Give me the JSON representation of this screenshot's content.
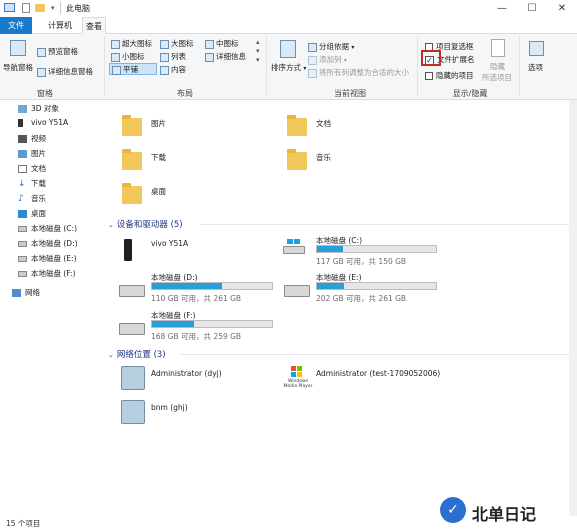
{
  "title": "此电脑",
  "window": {
    "minimize": "—",
    "maximize": "☐",
    "close": "✕"
  },
  "tabs": [
    {
      "label": "文件"
    },
    {
      "label": "计算机"
    },
    {
      "label": "查看"
    }
  ],
  "ribbon": {
    "pane_group": {
      "label": "窗格",
      "nav_pane": "导航窗格",
      "preview_pane": "预览窗格",
      "details_pane": "详细信息窗格"
    },
    "layout_group": {
      "label": "布局",
      "options": [
        "超大图标",
        "大图标",
        "中图标",
        "小图标",
        "列表",
        "详细信息",
        "平铺",
        "内容"
      ]
    },
    "current_view_group": {
      "label": "当前视图",
      "sort": "排序方式",
      "group_by": "分组依据",
      "add_column": "添加列",
      "fit_columns": "将所有列调整为合适的大小"
    },
    "show_hide_group": {
      "label": "显示/隐藏",
      "item_checkboxes": "项目复选框",
      "file_extensions": "文件扩展名",
      "hidden_items": "隐藏的项目",
      "hide": "隐藏",
      "selected_items": "所选项目"
    },
    "options": "选项"
  },
  "nav": {
    "items": [
      {
        "label": "3D 对象",
        "icon": "3d-objects-icon"
      },
      {
        "label": "vivo Y51A",
        "icon": "phone-icon"
      },
      {
        "label": "视频",
        "icon": "video-icon"
      },
      {
        "label": "图片",
        "icon": "pictures-icon"
      },
      {
        "label": "文档",
        "icon": "documents-icon"
      },
      {
        "label": "下载",
        "icon": "download-icon"
      },
      {
        "label": "音乐",
        "icon": "music-icon"
      },
      {
        "label": "桌面",
        "icon": "desktop-icon"
      },
      {
        "label": "本地磁盘 (C:)",
        "icon": "drive-icon"
      },
      {
        "label": "本地磁盘 (D:)",
        "icon": "drive-icon"
      },
      {
        "label": "本地磁盘 (E:)",
        "icon": "drive-icon"
      },
      {
        "label": "本地磁盘 (F:)",
        "icon": "drive-icon"
      },
      {
        "label": "网络",
        "icon": "network-icon"
      }
    ]
  },
  "folders": [
    {
      "label": "图片"
    },
    {
      "label": "文档"
    },
    {
      "label": "下载"
    },
    {
      "label": "音乐"
    },
    {
      "label": "桌面"
    }
  ],
  "devices": {
    "header": "设备和驱动器 (5)",
    "phone": "vivo Y51A",
    "drives": [
      {
        "name": "本地磁盘 (C:)",
        "info": "117 GB 可用，共 150 GB",
        "used_fraction": 0.22
      },
      {
        "name": "本地磁盘 (D:)",
        "info": "110 GB 可用，共 261 GB",
        "used_fraction": 0.58
      },
      {
        "name": "本地磁盘 (E:)",
        "info": "202 GB 可用，共 261 GB",
        "used_fraction": 0.23
      },
      {
        "name": "本地磁盘 (F:)",
        "info": "168 GB 可用，共 259 GB",
        "used_fraction": 0.35
      }
    ]
  },
  "network": {
    "header": "网络位置 (3)",
    "items": [
      "Administrator (dyj)",
      "Administrator (test-1709052006)",
      "bnm (ghj)"
    ],
    "media_player_text": "Windows Media Player"
  },
  "status": "15 个项目",
  "watermark": "北单日记",
  "colors": {
    "accent": "#1979ca",
    "bar": "#26a0da",
    "highlight": "#c42b1c"
  }
}
